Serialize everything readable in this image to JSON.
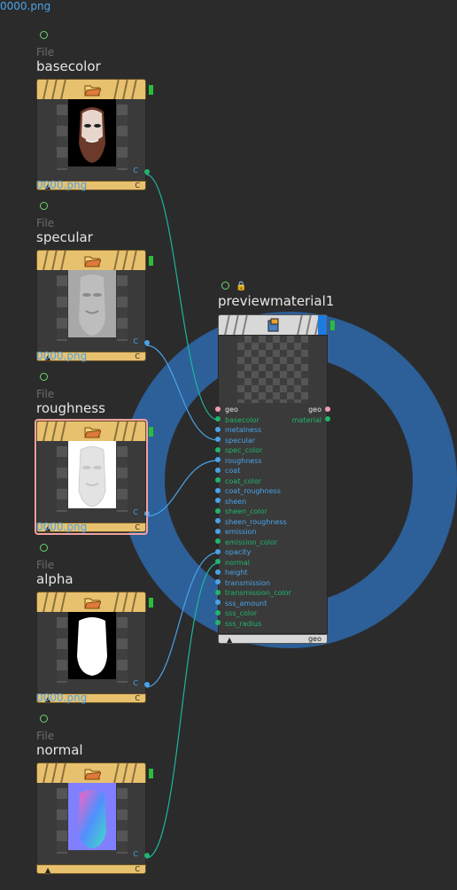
{
  "top_filename": "0000.png",
  "colors": {
    "background": "#2b2b2b",
    "file_header": "#e8c16f",
    "wire": "#1fb59a",
    "port_blue": "#4aa3e8",
    "port_green": "#21b56a",
    "port_pink": "#f29bb0",
    "display_flag": "#2bbd3a",
    "selection_ring": "#2d5f98"
  },
  "file_nodes": [
    {
      "type_label": "File",
      "name": "basecolor",
      "filename": "0000.png",
      "output": "C",
      "footer_right": "C",
      "thumbnail": "face-color"
    },
    {
      "type_label": "File",
      "name": "specular",
      "filename": "0000.png",
      "output": "C",
      "footer_right": "C",
      "thumbnail": "face-gray"
    },
    {
      "type_label": "File",
      "name": "roughness",
      "filename": "0000.png",
      "output": "C",
      "footer_right": "C",
      "thumbnail": "face-light"
    },
    {
      "type_label": "File",
      "name": "alpha",
      "filename": "0000.png",
      "output": "C",
      "footer_right": "C",
      "thumbnail": "mask"
    },
    {
      "type_label": "File",
      "name": "normal",
      "filename": "",
      "output": "C",
      "footer_right": "C",
      "thumbnail": "normal-map"
    }
  ],
  "preview_material": {
    "name": "previewmaterial1",
    "footer_right": "geo",
    "inputs": [
      {
        "label": "geo",
        "color": "pink"
      },
      {
        "label": "basecolor",
        "color": "green"
      },
      {
        "label": "metalness",
        "color": "blue"
      },
      {
        "label": "specular",
        "color": "blue"
      },
      {
        "label": "spec_color",
        "color": "green"
      },
      {
        "label": "roughness",
        "color": "blue"
      },
      {
        "label": "coat",
        "color": "blue"
      },
      {
        "label": "coat_color",
        "color": "green"
      },
      {
        "label": "coat_roughness",
        "color": "blue"
      },
      {
        "label": "sheen",
        "color": "blue"
      },
      {
        "label": "sheen_color",
        "color": "green"
      },
      {
        "label": "sheen_roughness",
        "color": "blue"
      },
      {
        "label": "emission",
        "color": "blue"
      },
      {
        "label": "emission_color",
        "color": "green"
      },
      {
        "label": "opacity",
        "color": "blue"
      },
      {
        "label": "normal",
        "color": "green"
      },
      {
        "label": "height",
        "color": "blue"
      },
      {
        "label": "transmission",
        "color": "blue"
      },
      {
        "label": "transmission_color",
        "color": "green"
      },
      {
        "label": "sss_amount",
        "color": "blue"
      },
      {
        "label": "sss_color",
        "color": "green"
      },
      {
        "label": "sss_radius",
        "color": "green"
      }
    ],
    "outputs": [
      {
        "label": "geo",
        "color": "pink"
      },
      {
        "label": "material",
        "color": "green"
      }
    ]
  }
}
